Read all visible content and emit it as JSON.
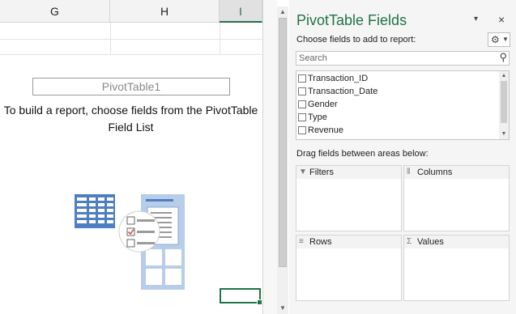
{
  "sheet": {
    "columns": [
      {
        "label": "G",
        "selected": false
      },
      {
        "label": "H",
        "selected": false
      },
      {
        "label": "I",
        "selected": true
      }
    ],
    "pivot": {
      "title": "PivotTable1",
      "instruction_line1": "To build a report, choose fields from the PivotTable",
      "instruction_line2": "Field List"
    }
  },
  "pane": {
    "title": "PivotTable Fields",
    "dropdown_icon": "▾",
    "close_icon": "×",
    "choose_label": "Choose fields to add to report:",
    "gear_icon": "⚙",
    "search_placeholder": "Search",
    "search_icon": "⚲",
    "fields": [
      {
        "label": "Transaction_ID",
        "checked": false
      },
      {
        "label": "Transaction_Date",
        "checked": false
      },
      {
        "label": "Gender",
        "checked": false
      },
      {
        "label": "Type",
        "checked": false
      },
      {
        "label": "Revenue",
        "checked": false
      }
    ],
    "drag_label": "Drag fields between areas below:",
    "areas": [
      {
        "name": "filters",
        "label": "Filters",
        "icon": "▼"
      },
      {
        "name": "columns",
        "label": "Columns",
        "icon": "⦀"
      },
      {
        "name": "rows",
        "label": "Rows",
        "icon": "≡"
      },
      {
        "name": "values",
        "label": "Values",
        "icon": "Σ"
      }
    ]
  },
  "colors": {
    "accent": "#217346",
    "pane_bg": "#f5f5f5",
    "illustration_blue": "#4e7fc1"
  }
}
